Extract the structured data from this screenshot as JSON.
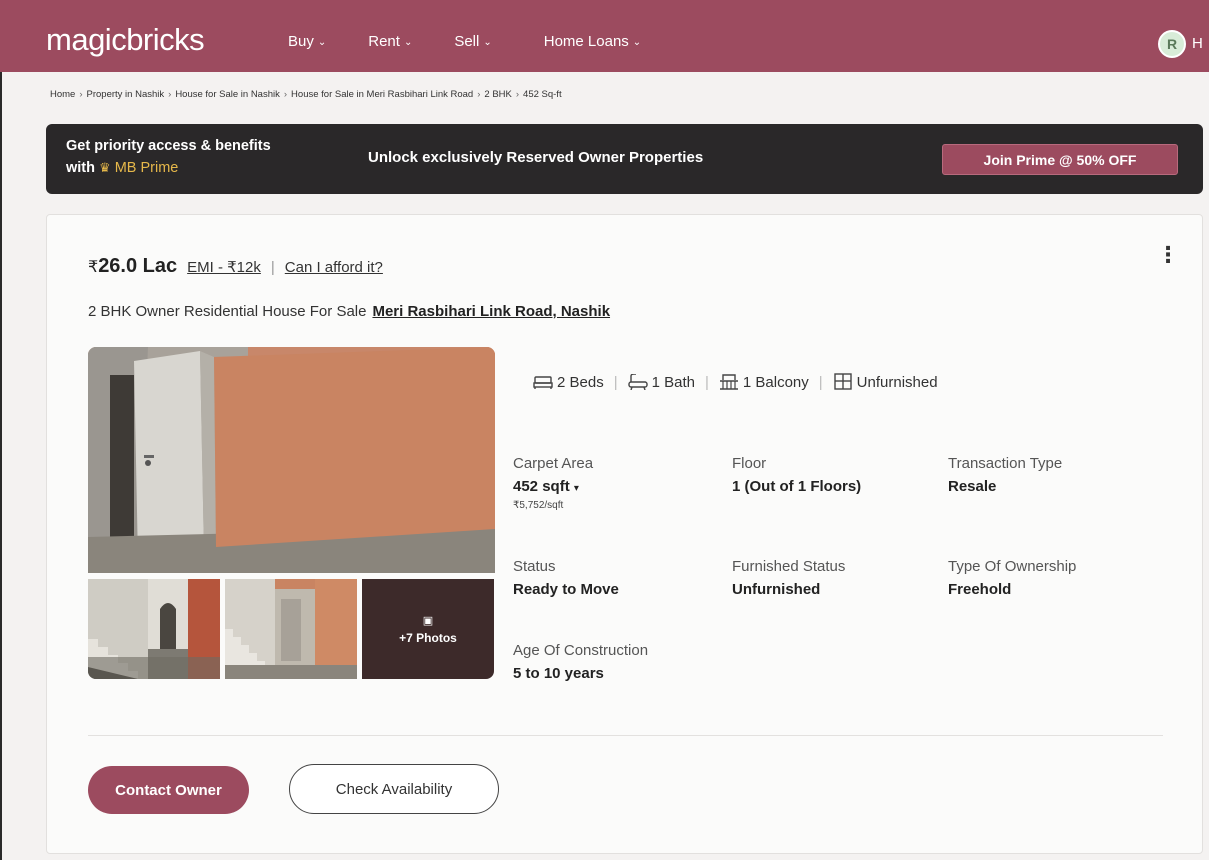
{
  "header": {
    "logo": "magicbricks",
    "nav": [
      {
        "label": "Buy"
      },
      {
        "label": "Rent"
      },
      {
        "label": "Sell"
      },
      {
        "label": "Home Loans"
      }
    ],
    "avatar_initial": "R",
    "avatar_text": "H"
  },
  "breadcrumb": [
    "Home",
    "Property in Nashik",
    "House for Sale in Nashik",
    "House for Sale in Meri Rasbihari Link Road",
    "2 BHK",
    "452 Sq-ft"
  ],
  "prime_banner": {
    "line1": "Get priority access & benefits",
    "with": "with",
    "brand": "MB Prime",
    "middle": "Unlock exclusively Reserved Owner Properties",
    "button": "Join Prime @ 50% OFF"
  },
  "listing": {
    "price": "26.0 Lac",
    "emi": "EMI - ₹12k",
    "pipe": "|",
    "afford": "Can I afford it?",
    "title": "2 BHK Owner Residential House For Sale",
    "location": "Meri Rasbihari Link Road, Nashik",
    "photos_more": "+7 Photos",
    "amenities": [
      {
        "icon": "bed-icon",
        "label": "2 Beds"
      },
      {
        "icon": "bath-icon",
        "label": "1 Bath"
      },
      {
        "icon": "balcony-icon",
        "label": "1 Balcony"
      },
      {
        "icon": "furnishing-icon",
        "label": "Unfurnished"
      }
    ],
    "details": {
      "carpet_area": {
        "label": "Carpet Area",
        "value": "452 sqft",
        "sub": "₹5,752/sqft"
      },
      "floor": {
        "label": "Floor",
        "value": "1 (Out of 1 Floors)"
      },
      "transaction": {
        "label": "Transaction Type",
        "value": "Resale"
      },
      "status": {
        "label": "Status",
        "value": "Ready to Move"
      },
      "furnished": {
        "label": "Furnished Status",
        "value": "Unfurnished"
      },
      "ownership": {
        "label": "Type Of Ownership",
        "value": "Freehold"
      },
      "age": {
        "label": "Age Of Construction",
        "value": "5 to 10 years"
      }
    },
    "buttons": {
      "contact": "Contact Owner",
      "check": "Check Availability"
    }
  },
  "colors": {
    "brand": "#9c4b5f",
    "banner_bg": "#2a2829",
    "prime_gold": "#e6b84a"
  }
}
